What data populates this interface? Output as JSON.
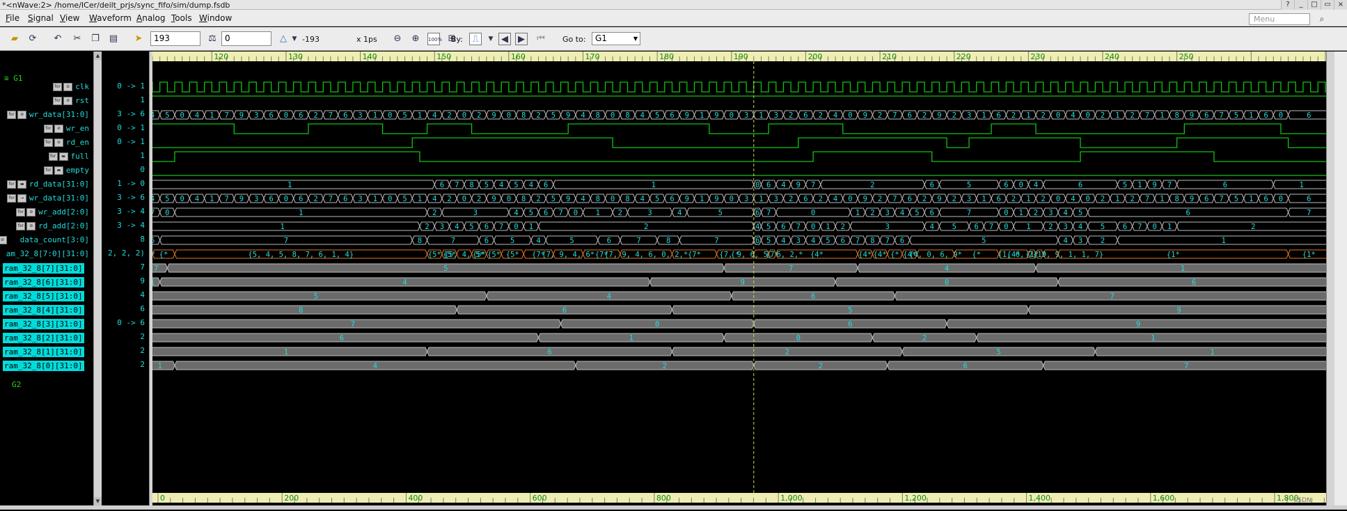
{
  "window": {
    "title": "*<nWave:2> /home/ICer/deilt_prjs/sync_fifo/sim/dump.fsdb",
    "buttons": [
      "?",
      "_",
      "□",
      "▭",
      "×"
    ]
  },
  "menu": {
    "items": [
      "File",
      "Signal",
      "View",
      "Waveform",
      "Analog",
      "Tools",
      "Window"
    ],
    "search_placeholder": "Menu"
  },
  "toolbar": {
    "cursor_time": "193",
    "marker_time": "0",
    "delta": "-193",
    "scale": "x 1ps",
    "by_label": "By:",
    "goto_label": "Go to:",
    "goto_value": "G1",
    "zoom_full": "100%"
  },
  "colors": {
    "signal_name": "#22dcdc",
    "wave_line": "#11c411",
    "bus_border": "#bdbdbd",
    "selected_bus_border": "#e8761e",
    "ram_bus_fill": "#6b6b6b",
    "cursor_line": "#d8d850",
    "group": "#26d426",
    "ruler_bg": "#eeeeb4",
    "ruler_text": "#0d8a0d"
  },
  "groups": {
    "g1": "G1",
    "g2": "G2"
  },
  "signals": [
    {
      "name": "clk",
      "value": "0 -> 1",
      "icons": [
        "clk",
        "dir"
      ]
    },
    {
      "name": "rst",
      "value": "1",
      "icons": [
        "clk",
        "dir"
      ]
    },
    {
      "name": "wr_data[31:0]",
      "value": "3 -> 6",
      "icons": [
        "clk",
        "dir"
      ]
    },
    {
      "name": "wr_en",
      "value": "0 -> 1",
      "icons": [
        "clk",
        "dir"
      ]
    },
    {
      "name": "rd_en",
      "value": "0 -> 1",
      "icons": [
        "clk",
        "dir"
      ]
    },
    {
      "name": "full",
      "value": "1",
      "icons": [
        "clk",
        "reg"
      ]
    },
    {
      "name": "empty",
      "value": "0",
      "icons": [
        "clk",
        "reg"
      ]
    },
    {
      "name": "rd_data[31:0]",
      "value": "1 -> 0",
      "icons": [
        "clk",
        "reg"
      ]
    },
    {
      "name": "wr_data[31:0]",
      "value": "3 -> 6",
      "icons": [
        "clk",
        "in"
      ]
    },
    {
      "name": "wr_add[2:0]",
      "value": "3 -> 4",
      "icons": [
        "clk",
        "dir"
      ]
    },
    {
      "name": "rd_add[2:0]",
      "value": "3 -> 4",
      "icons": [
        "clk",
        "dir"
      ]
    },
    {
      "name": "data_count[3:0]",
      "value": "8",
      "icons": [
        "dir"
      ]
    },
    {
      "name": "am_32_8[7:0][31:0]",
      "value": "2, 2, 2)",
      "icons": []
    },
    {
      "name": "ram_32_8[7][31:0]",
      "value": "7",
      "icons": [],
      "hl": true
    },
    {
      "name": "ram_32_8[6][31:0]",
      "value": "9",
      "icons": [],
      "hl": true
    },
    {
      "name": "ram_32_8[5][31:0]",
      "value": "4",
      "icons": [],
      "hl": true
    },
    {
      "name": "ram_32_8[4][31:0]",
      "value": "6",
      "icons": [],
      "hl": true
    },
    {
      "name": "ram_32_8[3][31:0]",
      "value": "0 -> 6",
      "icons": [],
      "hl": true
    },
    {
      "name": "ram_32_8[2][31:0]",
      "value": "2",
      "icons": [],
      "hl": true
    },
    {
      "name": "ram_32_8[1][31:0]",
      "value": "2",
      "icons": [],
      "hl": true
    },
    {
      "name": "ram_32_8[0][31:0]",
      "value": "2",
      "icons": [],
      "hl": true
    }
  ],
  "time_axis": {
    "top_labels": [
      "120",
      "130",
      "140",
      "150",
      "160",
      "170",
      "180",
      "190",
      "200",
      "210",
      "220",
      "230",
      "240",
      "250"
    ],
    "top_first": 120,
    "top_last": 250,
    "bottom_labels": [
      "0",
      "200",
      "400",
      "600",
      "800",
      "1,000",
      "1,200",
      "1,400",
      "1,600",
      "1,800"
    ],
    "bottom_last": 1800,
    "cursor": 193
  },
  "waves": {
    "clk": {
      "period": 2,
      "first_rise": 111
    },
    "wr_en": {
      "init": 1,
      "toggles": [
        123,
        133,
        143,
        149,
        155,
        168,
        187,
        195,
        205,
        225,
        231,
        251,
        264
      ]
    },
    "rd_en": {
      "init": 0,
      "toggles": [
        147,
        174,
        199,
        219,
        222,
        237,
        250,
        265
      ]
    },
    "full": {
      "init": 0,
      "toggles": [
        115,
        148,
        201,
        217,
        237,
        255
      ]
    },
    "empty": {
      "init": 0,
      "toggles": []
    }
  },
  "buses": {
    "wr_data": {
      "times": [
        111,
        113,
        115,
        117,
        119,
        121,
        123,
        125,
        127,
        129,
        131,
        133,
        135,
        137,
        139,
        141,
        143,
        145,
        147,
        149,
        151,
        153,
        155,
        157,
        159,
        161,
        163,
        165,
        167,
        169,
        171,
        173,
        175,
        177,
        179,
        181,
        183,
        185,
        187,
        189,
        191,
        193,
        195,
        197,
        199,
        201,
        203,
        205,
        207,
        209,
        211,
        213,
        215,
        217,
        219,
        221,
        223,
        225,
        227,
        229,
        231,
        233,
        235,
        237,
        239,
        241,
        243,
        245,
        247,
        249,
        251,
        253,
        255,
        257,
        259,
        261,
        263,
        265
      ],
      "values": [
        "4",
        "5",
        "0",
        "4",
        "1",
        "7",
        "9",
        "3",
        "6",
        "0",
        "6",
        "2",
        "7",
        "6",
        "3",
        "1",
        "0",
        "5",
        "1",
        "4",
        "2",
        "0",
        "2",
        "9",
        "0",
        "8",
        "2",
        "5",
        "9",
        "4",
        "8",
        "0",
        "8",
        "4",
        "5",
        "6",
        "9",
        "1",
        "9",
        "0",
        "3",
        "1",
        "3",
        "2",
        "6",
        "2",
        "4",
        "0",
        "9",
        "2",
        "7",
        "6",
        "2",
        "9",
        "2",
        "3",
        "1",
        "6",
        "2",
        "1",
        "2",
        "0",
        "4",
        "0",
        "2",
        "1",
        "2",
        "7",
        "1",
        "8",
        "9",
        "6",
        "7",
        "5",
        "1",
        "6",
        "0",
        "6"
      ]
    },
    "rd_data": {
      "times": [
        111,
        150,
        152,
        154,
        156,
        158,
        160,
        162,
        164,
        166,
        193,
        194,
        196,
        198,
        200,
        202,
        216,
        218,
        226,
        228,
        230,
        232,
        242,
        244,
        246,
        248,
        250,
        263
      ],
      "values": [
        "1",
        "6",
        "7",
        "8",
        "5",
        "4",
        "5",
        "4",
        "6",
        "1",
        "0",
        "6",
        "4",
        "9",
        "7",
        "2",
        "6",
        "5",
        "6",
        "0",
        "4",
        "6",
        "5",
        "1",
        "9",
        "7",
        "6",
        "1"
      ]
    },
    "wr_add": {
      "times": [
        111,
        113,
        115,
        149,
        151,
        160,
        162,
        164,
        166,
        168,
        170,
        174,
        176,
        182,
        184,
        193,
        194,
        196,
        206,
        208,
        210,
        212,
        214,
        216,
        218,
        226,
        228,
        230,
        232,
        234,
        236,
        238,
        265
      ],
      "values": [
        "7",
        "0",
        "1",
        "2",
        "3",
        "4",
        "5",
        "6",
        "7",
        "0",
        "1",
        "2",
        "3",
        "4",
        "5",
        "6",
        "7",
        "0",
        "1",
        "2",
        "3",
        "4",
        "5",
        "6",
        "7",
        "0",
        "1",
        "2",
        "3",
        "4",
        "5",
        "6",
        "7"
      ]
    },
    "rd_add": {
      "times": [
        111,
        148,
        150,
        152,
        154,
        156,
        158,
        160,
        162,
        164,
        193,
        194,
        196,
        198,
        200,
        202,
        204,
        206,
        216,
        218,
        222,
        224,
        226,
        228,
        232,
        234,
        236,
        238,
        242,
        244,
        246,
        248,
        250
      ],
      "values": [
        "1",
        "2",
        "3",
        "4",
        "5",
        "6",
        "7",
        "0",
        "1",
        "2",
        "4",
        "5",
        "6",
        "7",
        "0",
        "1",
        "2",
        "3",
        "4",
        "5",
        "6",
        "7",
        "0",
        "1",
        "2",
        "3",
        "4",
        "5",
        "6",
        "7",
        "0",
        "1",
        "2"
      ]
    },
    "data_count": {
      "times": [
        111,
        113,
        147,
        149,
        156,
        158,
        163,
        165,
        172,
        175,
        180,
        183,
        193,
        194,
        196,
        198,
        200,
        202,
        204,
        206,
        208,
        210,
        212,
        214,
        234,
        236,
        238,
        242
      ],
      "values": [
        "6",
        "7",
        "8",
        "7",
        "6",
        "5",
        "4",
        "5",
        "6",
        "7",
        "8",
        "7",
        "6",
        "5",
        "4",
        "3",
        "4",
        "5",
        "6",
        "7",
        "8",
        "7",
        "6",
        "5",
        "4",
        "3",
        "2",
        "1"
      ]
    },
    "ram": {
      "times": [
        111,
        112,
        115,
        149,
        151,
        153,
        155,
        157,
        159,
        162,
        166,
        170,
        175,
        182,
        188,
        193,
        195,
        196,
        207,
        209,
        211,
        213,
        215,
        220,
        226,
        230,
        231,
        232,
        234,
        265
      ],
      "values": [
        "{7*",
        "{*",
        "{5, 4, 5, 8, 7, 6, 1, 4}",
        "{5*",
        "{5*",
        "{5, 4, 5*",
        "{5*",
        "{5*",
        "{5*",
        "{7*",
        "{7, 9, 4, 6*",
        "{7*",
        "{7, 9, 4, 6, 0, 2,*",
        "{7*",
        "{*",
        "{7, 9, 6, 5, 6, 2,*",
        "{7*",
        "{4*",
        "{4*",
        "{4*",
        "{*",
        "{4*",
        "{4, 0, 6, 9*",
        "{*",
        "{4*",
        "{1*",
        "{1*",
        "{1, 6, 7, 9, 9, 1, 1, 7}",
        "{1*",
        "{1*"
      ]
    },
    "r7": {
      "times": [
        111,
        114,
        189,
        207,
        231
      ],
      "values": [
        "7",
        "5",
        "7",
        "4",
        "1"
      ]
    },
    "r6": {
      "times": [
        111,
        113,
        179,
        204,
        234
      ],
      "values": [
        "1",
        "4",
        "9",
        "0",
        "6"
      ]
    },
    "r5": {
      "times": [
        111,
        157,
        190,
        212
      ],
      "values": [
        "5",
        "4",
        "6",
        "7"
      ]
    },
    "r4": {
      "times": [
        111,
        153,
        182,
        230
      ],
      "values": [
        "8",
        "6",
        "5",
        "9"
      ]
    },
    "r3": {
      "times": [
        111,
        167,
        193,
        219
      ],
      "values": [
        "7",
        "0",
        "6",
        "9"
      ]
    },
    "r2": {
      "times": [
        111,
        164,
        189,
        209,
        223
      ],
      "values": [
        "6",
        "1",
        "0",
        "2",
        "1"
      ]
    },
    "r1": {
      "times": [
        111,
        149,
        182,
        213,
        239
      ],
      "values": [
        "1",
        "6",
        "2",
        "5",
        "1"
      ]
    },
    "r0": {
      "times": [
        111,
        115,
        169,
        193,
        211,
        232
      ],
      "values": [
        "1",
        "4",
        "2",
        "2",
        "6",
        "7"
      ]
    }
  }
}
